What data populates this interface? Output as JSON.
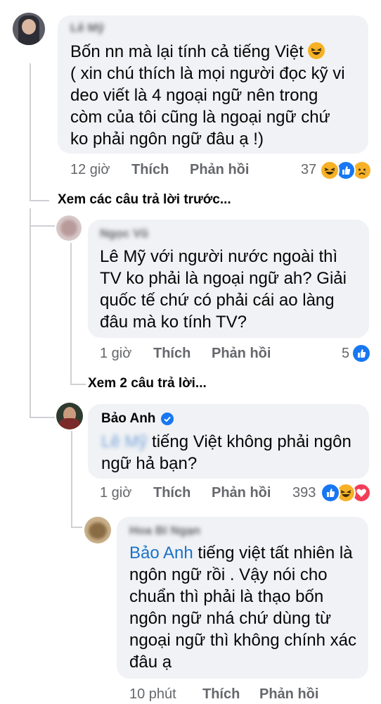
{
  "comments": [
    {
      "author": "Lê Mỹ",
      "text": "Bốn nn mà lại tính cả tiếng Việt",
      "text2": "( xin chú thích là mọi người đọc kỹ vi deo viết là 4 ngoại ngữ nên trong còm của tôi cũng là ngoại ngữ chứ ko phải ngôn ngữ đâu ạ !)",
      "time": "12 giờ",
      "like": "Thích",
      "reply": "Phản hồi",
      "reaction_count": "37",
      "reactions": [
        "haha-icon",
        "like-icon",
        "sad-icon"
      ]
    },
    {
      "author": "Ngọc Vũ",
      "text": "Lê Mỹ với người nước ngoài thì TV ko phải là ngoại ngữ ah? Giải quốc tế chứ có phải cái ao làng đâu mà ko tính TV?",
      "time": "1 giờ",
      "like": "Thích",
      "reply": "Phản hồi",
      "reaction_count": "5",
      "reactions": [
        "like-icon"
      ]
    },
    {
      "author": "Bảo Anh",
      "mention": "Lê Mỹ",
      "text": "tiếng Việt không phải ngôn ngữ hả bạn?",
      "time": "1 giờ",
      "like": "Thích",
      "reply": "Phản hồi",
      "reaction_count": "393",
      "reactions": [
        "like-icon",
        "haha-icon",
        "love-icon"
      ]
    },
    {
      "author": "Hoa Bỉ Ngạn",
      "mention": "Bảo Anh",
      "text": "tiếng việt tất nhiên là ngôn ngữ rồi . Vậy nói cho chuẩn thì phải là thạo bốn ngôn ngữ nhá chứ dùng từ ngoại ngữ thì không chính xác đâu ạ",
      "time": "10 phút",
      "like": "Thích",
      "reply": "Phản hồi"
    }
  ],
  "view_previous": "Xem các câu trả lời trước...",
  "view_replies": "Xem 2 câu trả lời...",
  "colors": {
    "bubble": "#f0f2f5",
    "meta": "#65676b",
    "mention": "#1a73c8",
    "like": "#1877f2",
    "haha": "#f7b125",
    "love": "#f33e58"
  }
}
